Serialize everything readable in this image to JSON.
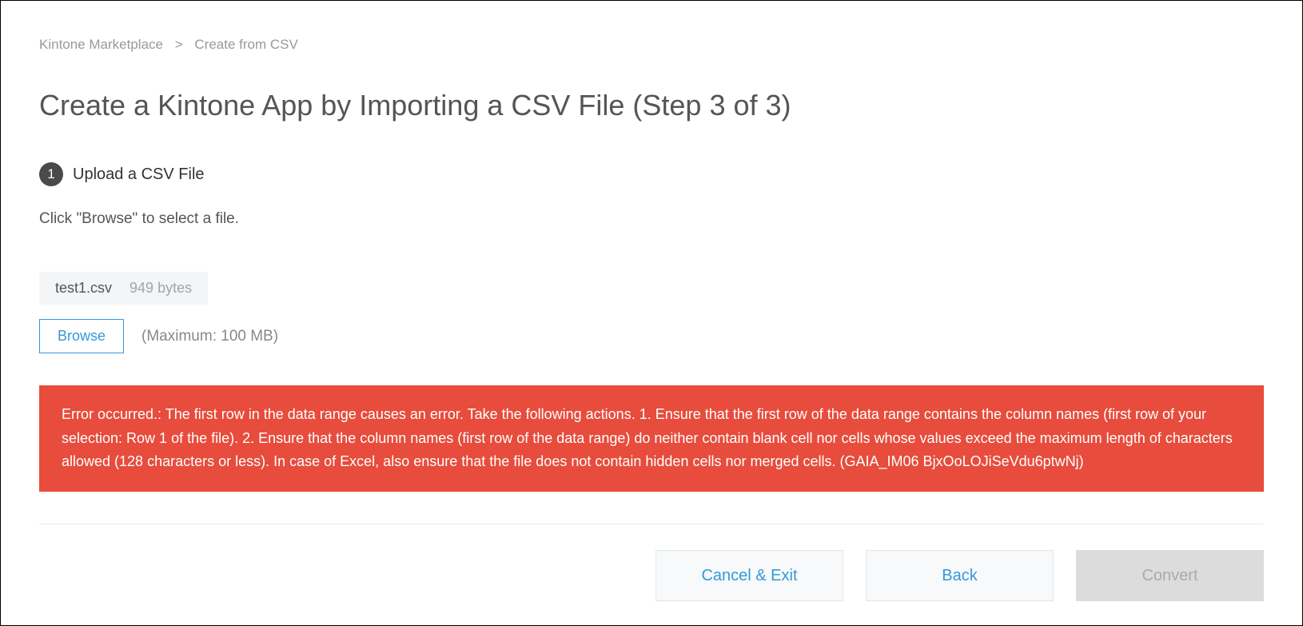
{
  "breadcrumb": {
    "root": "Kintone Marketplace",
    "sep": ">",
    "current": "Create from CSV"
  },
  "page_title": "Create a Kintone App by Importing a CSV File (Step 3 of 3)",
  "step": {
    "number": "1",
    "title": "Upload a CSV File"
  },
  "instruction": "Click \"Browse\" to select a file.",
  "file": {
    "name": "test1.csv",
    "size": "949 bytes"
  },
  "browse": {
    "label": "Browse",
    "max_hint": "(Maximum: 100 MB)"
  },
  "error": {
    "message": "Error occurred.: The first row in the data range causes an error. Take the following actions. 1. Ensure that the first row of the data range contains the column names (first row of your selection: Row 1 of the file). 2. Ensure that the column names (first row of the data range) do neither contain blank cell nor cells whose values exceed the maximum length of characters allowed (128 characters or less). In case of Excel, also ensure that the file does not contain hidden cells nor merged cells. (GAIA_IM06 BjxOoLOJiSeVdu6ptwNj)"
  },
  "actions": {
    "cancel": "Cancel & Exit",
    "back": "Back",
    "convert": "Convert"
  }
}
